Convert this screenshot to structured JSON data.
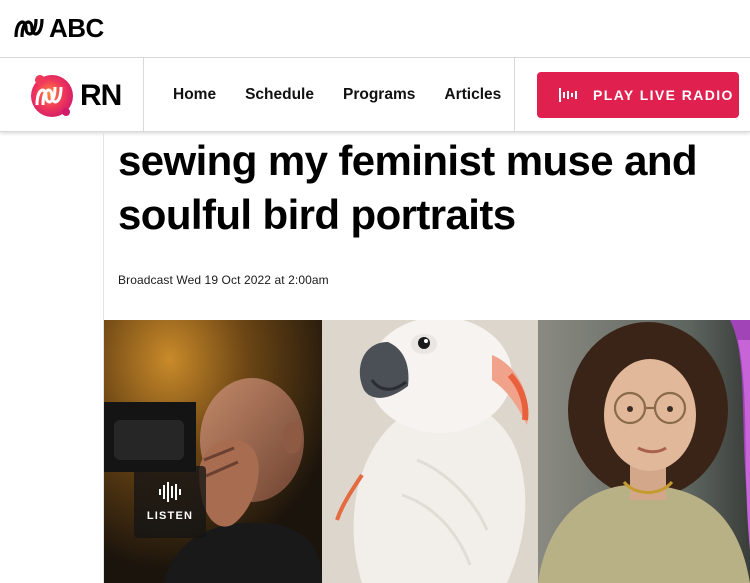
{
  "abc_bar": {
    "logo_text": "ABC"
  },
  "rn_header": {
    "logo_text": "RN",
    "nav": [
      "Home",
      "Schedule",
      "Programs",
      "Articles"
    ],
    "play_button_label": "PLAY LIVE RADIO",
    "play_button_color": "#e0204e"
  },
  "article": {
    "headline_line1": "sewing my feminist muse and",
    "headline_line2": "soulful bird portraits",
    "broadcast": "Broadcast Wed 19 Oct 2022 at 2:00am"
  },
  "hero": {
    "listen_label": "LISTEN",
    "listen_icon": "audio-waveform-icon"
  },
  "icons": {
    "abc": "abc-lissajous-icon",
    "rn": "rn-lissajous-icon",
    "play": "waveform-icon"
  }
}
